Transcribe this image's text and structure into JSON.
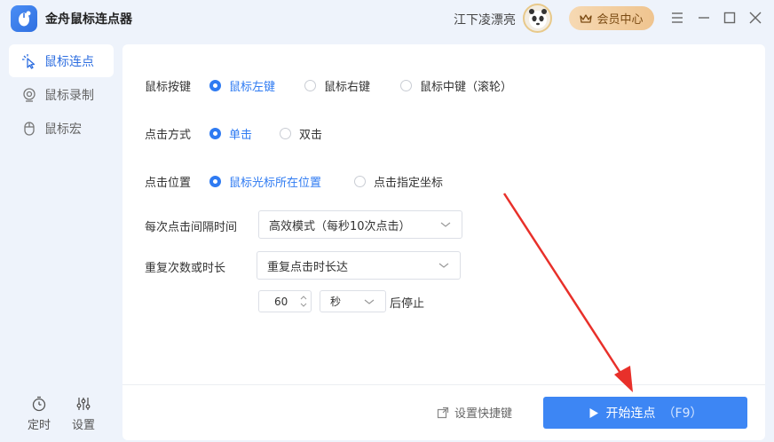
{
  "app": {
    "title": "金舟鼠标连点器",
    "username": "江下凌漂亮",
    "vip_label": "会员中心"
  },
  "sidebar": {
    "items": [
      {
        "label": "鼠标连点",
        "icon": "cursor-click-icon",
        "active": true
      },
      {
        "label": "鼠标录制",
        "icon": "record-icon",
        "active": false
      },
      {
        "label": "鼠标宏",
        "icon": "mouse-icon",
        "active": false
      }
    ],
    "bottom": [
      {
        "label": "定时",
        "icon": "timer-icon"
      },
      {
        "label": "设置",
        "icon": "sliders-icon"
      }
    ]
  },
  "main": {
    "mouse_button": {
      "label": "鼠标按键",
      "options": [
        "鼠标左键",
        "鼠标右键",
        "鼠标中键（滚轮）"
      ],
      "selected": 0
    },
    "click_mode": {
      "label": "点击方式",
      "options": [
        "单击",
        "双击"
      ],
      "selected": 0
    },
    "click_position": {
      "label": "点击位置",
      "options": [
        "鼠标光标所在位置",
        "点击指定坐标"
      ],
      "selected": 0
    },
    "interval": {
      "label": "每次点击间隔时间",
      "value": "高效模式（每秒10次点击）"
    },
    "repeat": {
      "label": "重复次数或时长",
      "value": "重复点击时长达"
    },
    "duration": {
      "value": "60",
      "unit": "秒",
      "suffix": "后停止"
    },
    "shortcut_label": "设置快捷键",
    "start_label": "开始连点",
    "start_hotkey": "（F9）"
  },
  "colors": {
    "accent": "#2f7bf2",
    "button": "#3d86f4",
    "arrow": "#e8302a"
  }
}
